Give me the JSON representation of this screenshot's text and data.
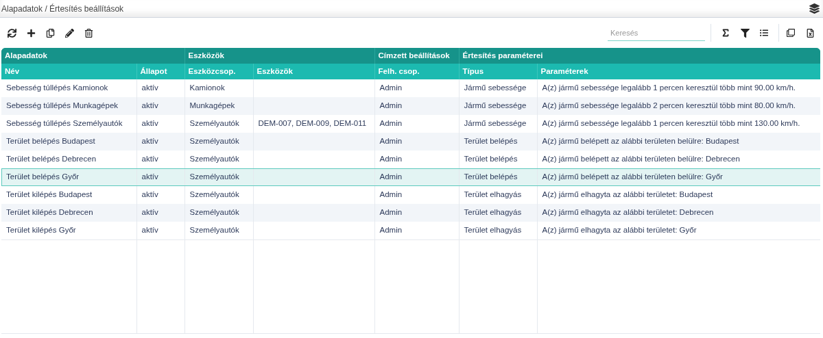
{
  "breadcrumb": "Alapadatok / Értesítés beállítások",
  "search": {
    "placeholder": "Keresés"
  },
  "table": {
    "groups": [
      {
        "label": "Alapadatok",
        "columns": [
          "Név",
          "Állapot"
        ]
      },
      {
        "label": "Eszközök",
        "columns": [
          "Eszközcsop.",
          "Eszközök"
        ]
      },
      {
        "label": "Címzett beállítások",
        "columns": [
          "Felh. csop."
        ]
      },
      {
        "label": "Értesítés paraméterei",
        "columns": [
          "Típus",
          "Paraméterek"
        ]
      }
    ],
    "rows": [
      {
        "selected": false,
        "cells": [
          "Sebesség túllépés Kamionok",
          "aktív",
          "Kamionok",
          "",
          "Admin",
          "Jármű sebessége",
          "A(z) jármű sebessége legalább 1 percen keresztül több mint 90.00 km/h."
        ]
      },
      {
        "selected": false,
        "cells": [
          "Sebesség túllépés Munkagépek",
          "aktív",
          "Munkagépek",
          "",
          "Admin",
          "Jármű sebessége",
          "A(z) jármű sebessége legalább 2 percen keresztül több mint 80.00 km/h."
        ]
      },
      {
        "selected": false,
        "cells": [
          "Sebesség túllépés Személyautók",
          "aktív",
          "Személyautók",
          "DEM-007, DEM-009, DEM-011",
          "Admin",
          "Jármű sebessége",
          "A(z) jármű sebessége legalább 1 percen keresztül több mint 130.00 km/h."
        ]
      },
      {
        "selected": false,
        "cells": [
          "Terület belépés Budapest",
          "aktív",
          "Személyautók",
          "",
          "Admin",
          "Terület belépés",
          "A(z) jármű belépett az alábbi területen belülre: Budapest"
        ]
      },
      {
        "selected": false,
        "cells": [
          "Terület belépés Debrecen",
          "aktív",
          "Személyautók",
          "",
          "Admin",
          "Terület belépés",
          "A(z) jármű belépett az alábbi területen belülre: Debrecen"
        ]
      },
      {
        "selected": true,
        "cells": [
          "Terület belépés Győr",
          "aktív",
          "Személyautók",
          "",
          "Admin",
          "Terület belépés",
          "A(z) jármű belépett az alábbi területen belülre: Győr"
        ]
      },
      {
        "selected": false,
        "cells": [
          "Terület kilépés Budapest",
          "aktív",
          "Személyautók",
          "",
          "Admin",
          "Terület elhagyás",
          "A(z) jármű elhagyta az alábbi területet: Budapest"
        ]
      },
      {
        "selected": false,
        "cells": [
          "Terület kilépés Debrecen",
          "aktív",
          "Személyautók",
          "",
          "Admin",
          "Terület elhagyás",
          "A(z) jármű elhagyta az alábbi területet: Debrecen"
        ]
      },
      {
        "selected": false,
        "cells": [
          "Terület kilépés Győr",
          "aktív",
          "Személyautók",
          "",
          "Admin",
          "Terület elhagyás",
          "A(z) jármű elhagyta az alábbi területet: Győr"
        ]
      }
    ]
  }
}
